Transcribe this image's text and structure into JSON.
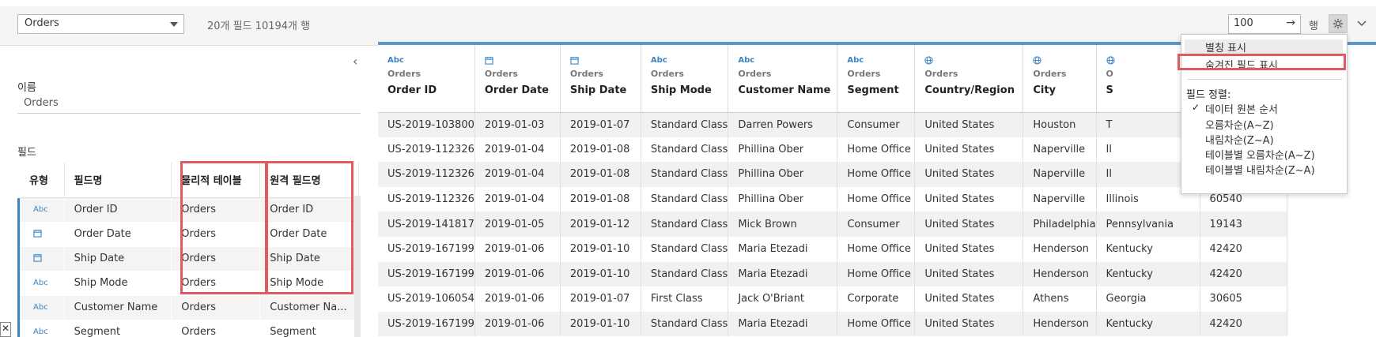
{
  "toolbar": {
    "source_select": "Orders",
    "field_count": "20개 필드 10194개 행",
    "rows_value": "100",
    "rows_arrow": "→",
    "rows_label": "행",
    "gear_icon": "gear-icon",
    "expand_icon": "chevron-down-icon"
  },
  "left": {
    "collapse_icon": "‹",
    "name_label": "이름",
    "name_value": "Orders",
    "fields_label": "필드",
    "headers": {
      "type": "유형",
      "field_name": "필드명",
      "physical_table": "물리적 테이블",
      "remote_field": "원격 필드명"
    },
    "rows": [
      {
        "type": "Abc",
        "name": "Order ID",
        "table": "Orders",
        "remote": "Order ID"
      },
      {
        "type": "date",
        "name": "Order Date",
        "table": "Orders",
        "remote": "Order Date"
      },
      {
        "type": "date",
        "name": "Ship Date",
        "table": "Orders",
        "remote": "Ship Date"
      },
      {
        "type": "Abc",
        "name": "Ship Mode",
        "table": "Orders",
        "remote": "Ship Mode"
      },
      {
        "type": "Abc",
        "name": "Customer Name",
        "table": "Orders",
        "remote": "Customer Na..."
      },
      {
        "type": "Abc",
        "name": "Segment",
        "table": "Orders",
        "remote": "Segment"
      }
    ],
    "close_icon": "✕"
  },
  "grid": {
    "columns": [
      {
        "type": "Abc",
        "source": "Orders",
        "name": "Order ID"
      },
      {
        "type": "date",
        "source": "Orders",
        "name": "Order Date"
      },
      {
        "type": "date",
        "source": "Orders",
        "name": "Ship Date"
      },
      {
        "type": "Abc",
        "source": "Orders",
        "name": "Ship Mode"
      },
      {
        "type": "Abc",
        "source": "Orders",
        "name": "Customer Name"
      },
      {
        "type": "Abc",
        "source": "Orders",
        "name": "Segment"
      },
      {
        "type": "globe",
        "source": "Orders",
        "name": "Country/Region"
      },
      {
        "type": "globe",
        "source": "Orders",
        "name": "City"
      },
      {
        "type": "globe",
        "source": "O",
        "name": "S"
      },
      {
        "type": "",
        "source": "",
        "name": ""
      }
    ],
    "rows": [
      [
        "US-2019-103800",
        "2019-01-03",
        "2019-01-07",
        "Standard Class",
        "Darren Powers",
        "Consumer",
        "United States",
        "Houston",
        "T",
        ""
      ],
      [
        "US-2019-112326",
        "2019-01-04",
        "2019-01-08",
        "Standard Class",
        "Phillina Ober",
        "Home Office",
        "United States",
        "Naperville",
        "Il",
        ""
      ],
      [
        "US-2019-112326",
        "2019-01-04",
        "2019-01-08",
        "Standard Class",
        "Phillina Ober",
        "Home Office",
        "United States",
        "Naperville",
        "Il",
        ""
      ],
      [
        "US-2019-112326",
        "2019-01-04",
        "2019-01-08",
        "Standard Class",
        "Phillina Ober",
        "Home Office",
        "United States",
        "Naperville",
        "Illinois",
        "60540"
      ],
      [
        "US-2019-141817",
        "2019-01-05",
        "2019-01-12",
        "Standard Class",
        "Mick Brown",
        "Consumer",
        "United States",
        "Philadelphia",
        "Pennsylvania",
        "19143"
      ],
      [
        "US-2019-167199",
        "2019-01-06",
        "2019-01-10",
        "Standard Class",
        "Maria Etezadi",
        "Home Office",
        "United States",
        "Henderson",
        "Kentucky",
        "42420"
      ],
      [
        "US-2019-167199",
        "2019-01-06",
        "2019-01-10",
        "Standard Class",
        "Maria Etezadi",
        "Home Office",
        "United States",
        "Henderson",
        "Kentucky",
        "42420"
      ],
      [
        "US-2019-106054",
        "2019-01-06",
        "2019-01-07",
        "First Class",
        "Jack O'Briant",
        "Corporate",
        "United States",
        "Athens",
        "Georgia",
        "30605"
      ],
      [
        "US-2019-167199",
        "2019-01-06",
        "2019-01-10",
        "Standard Class",
        "Maria Etezadi",
        "Home Office",
        "United States",
        "Henderson",
        "Kentucky",
        "42420"
      ]
    ]
  },
  "menu": {
    "show_alias": "별칭 표시",
    "show_hidden": "숨겨진 필드 표시",
    "sort_title": "필드 정렬:",
    "check": "✓",
    "sort_options": [
      "데이터 원본 순서",
      "오름차순(A~Z)",
      "내림차순(Z~A)",
      "테이블별 오름차순(A~Z)",
      "테이블별 내림차순(Z~A)"
    ]
  },
  "colors": {
    "accent": "#3b84c4",
    "highlight": "#e05a64"
  }
}
